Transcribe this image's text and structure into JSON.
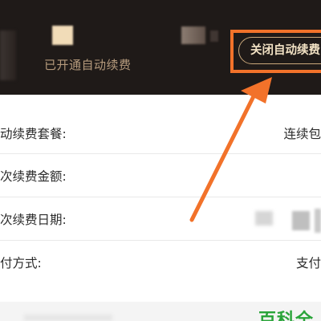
{
  "header": {
    "auto_renew_status": "已开通自动续费",
    "close_auto_renew_button": "关闭自动续费"
  },
  "details": {
    "rows": [
      {
        "label": "动续费套餐:",
        "value": "连续包"
      },
      {
        "label": "次续费金额:",
        "value": ""
      },
      {
        "label": "次续费日期:",
        "value": ""
      },
      {
        "label": "付方式:",
        "value": "支付"
      }
    ]
  },
  "watermark": {
    "text": "百科全"
  },
  "colors": {
    "header_background": "#1f1a18",
    "highlight_orange": "#f2722a",
    "button_border_gold": "#c9a77a",
    "status_text": "#b59a7c",
    "watermark_green": "#2aa43a"
  },
  "icons": {
    "annotation": "arrow-pointer-icon"
  }
}
